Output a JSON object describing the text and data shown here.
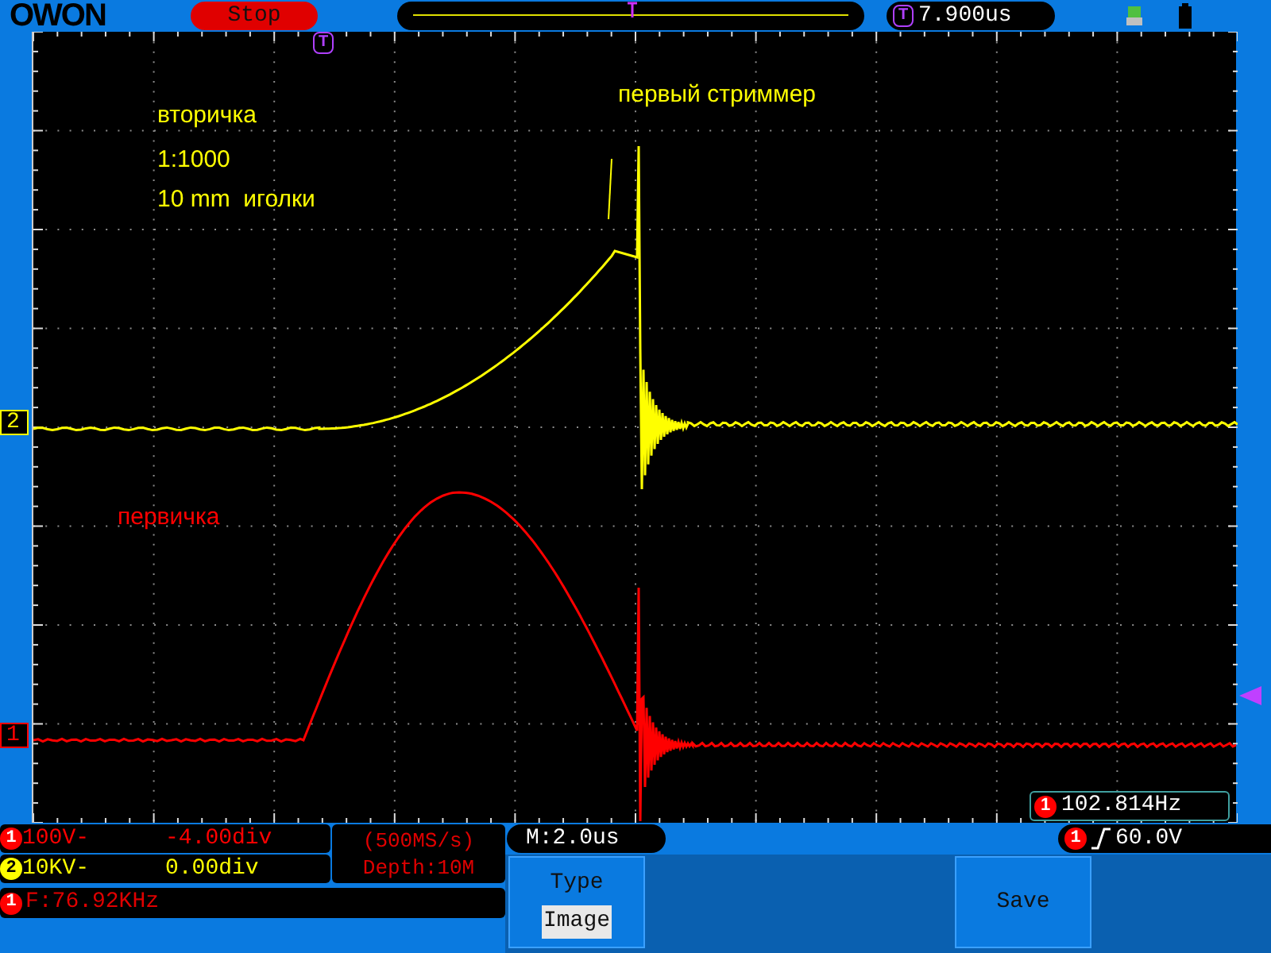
{
  "header": {
    "logo": "OWON",
    "run_state": "Stop",
    "trigger_marks": [
      "T",
      "T"
    ],
    "trigger_position": "7.900us"
  },
  "plot": {
    "channel_markers": [
      {
        "label": "2",
        "color": "#ffff00"
      },
      {
        "label": "1",
        "color": "#ff0000"
      }
    ],
    "annotations": [
      {
        "text": "вторичка",
        "color": "#ffff00"
      },
      {
        "text": "1:1000",
        "color": "#ffff00"
      },
      {
        "text": "10 mm  иголки",
        "color": "#ffff00"
      },
      {
        "text": "первый стриммер",
        "color": "#ffff00"
      },
      {
        "text": "первичка",
        "color": "#ff0000"
      }
    ],
    "frequency": {
      "channel": "1",
      "value": "102.814Hz"
    }
  },
  "channels": [
    {
      "label": "1",
      "scale": "100V-",
      "offset": "-4.00div",
      "color": "#ff0000"
    },
    {
      "label": "2",
      "scale": "10KV-",
      "offset": "0.00div",
      "color": "#ffff00"
    }
  ],
  "acquisition": {
    "sample_rate": "(500MS/s)",
    "depth": "Depth:10M"
  },
  "frequency_counter": {
    "channel": "1",
    "value": "F:76.92KHz"
  },
  "timebase": "M:2.0us",
  "trigger": {
    "channel": "1",
    "value": "60.0V"
  },
  "menu": [
    {
      "kind": "option",
      "title": "Type",
      "value": "Image"
    },
    {
      "kind": "action",
      "title": "Save"
    }
  ]
}
